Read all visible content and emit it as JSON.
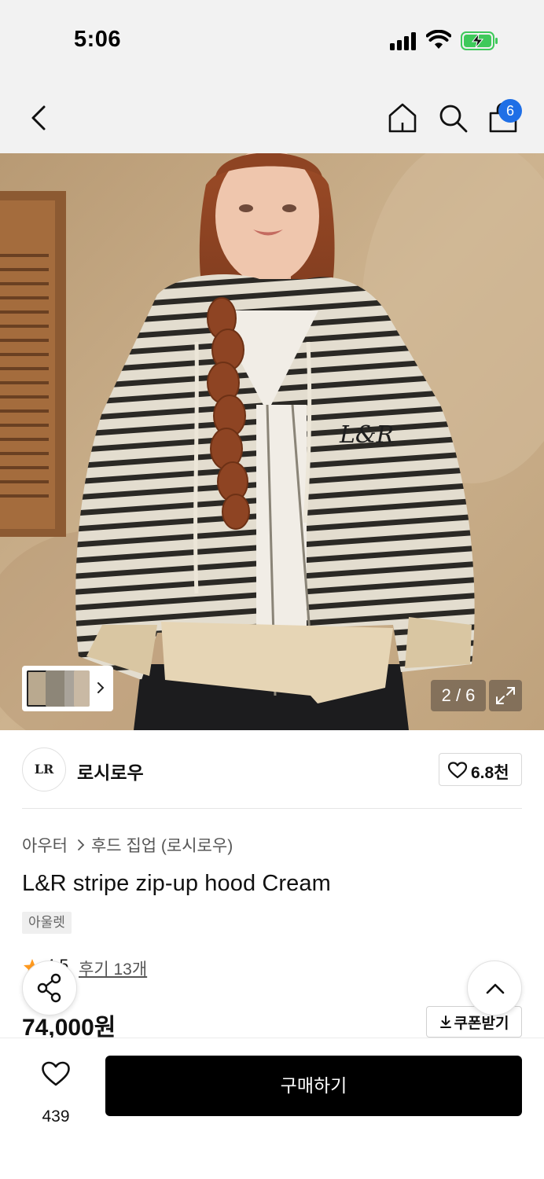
{
  "status_bar": {
    "time": "5:06"
  },
  "header": {
    "cart_count": "6",
    "icons": [
      "back-icon",
      "home-icon",
      "search-icon",
      "shopping-bag-icon"
    ]
  },
  "gallery": {
    "page_indicator": "2 / 6",
    "current_page": 2,
    "total_pages": 6
  },
  "brand": {
    "name": "로시로우",
    "logo_text": "LR",
    "like_count": "6.8천"
  },
  "product": {
    "breadcrumb": [
      "아우터",
      "후드 집업 (로시로우)"
    ],
    "title": "L&R stripe zip-up hood Cream",
    "tag": "아울렛",
    "rating": "4.5",
    "review_link": "후기 13개",
    "price": "74,000원",
    "coupon_label": "쿠폰받기"
  },
  "bottom_bar": {
    "wish_count": "439",
    "buy_label": "구매하기"
  },
  "colors": {
    "badge_blue": "#1f6fe6",
    "battery_green": "#3ec95a",
    "star_orange": "#ff9a1f",
    "buy_button": "#000000"
  }
}
